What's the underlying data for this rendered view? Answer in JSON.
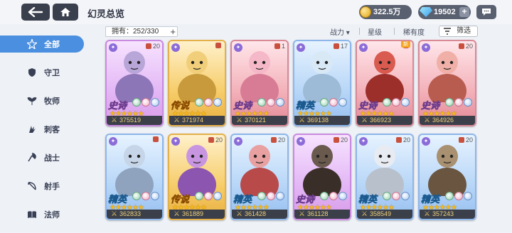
{
  "header": {
    "title": "幻灵总览",
    "gold": "322.5万",
    "gems": "19502"
  },
  "sidebar": {
    "items": [
      {
        "label": "全部",
        "icon": "star-burst-icon",
        "active": true
      },
      {
        "label": "守卫",
        "icon": "shield-icon",
        "active": false
      },
      {
        "label": "牧师",
        "icon": "wings-icon",
        "active": false
      },
      {
        "label": "刺客",
        "icon": "claw-icon",
        "active": false
      },
      {
        "label": "战士",
        "icon": "axe-icon",
        "active": false
      },
      {
        "label": "射手",
        "icon": "bow-icon",
        "active": false
      },
      {
        "label": "法师",
        "icon": "book-icon",
        "active": false
      }
    ]
  },
  "toolbar": {
    "owned_label": "拥有：252/330",
    "sort_power": "战力 ▾",
    "sort_star": "星级",
    "sort_rarity": "稀有度",
    "filter_label": "筛选"
  },
  "colors": {
    "accent": "#4a8fe0",
    "topbar_button": "#3a3f4e",
    "power_bar": "#3b3f4a"
  },
  "cards": [
    {
      "grade": "史诗",
      "level": "20",
      "power": "375519",
      "rarity": "epic",
      "new": false
    },
    {
      "grade": "传说",
      "level": "",
      "power": "371974",
      "rarity": "legend",
      "new": false
    },
    {
      "grade": "史诗",
      "level": "1",
      "power": "370121",
      "rarity": "epic-red",
      "new": false
    },
    {
      "grade": "精英",
      "level": "17",
      "power": "369138",
      "rarity": "elite",
      "new": false
    },
    {
      "grade": "史诗",
      "level": "",
      "power": "366923",
      "rarity": "epic-red",
      "new": true
    },
    {
      "grade": "史诗",
      "level": "20",
      "power": "364926",
      "rarity": "epic-red",
      "new": false
    },
    {
      "grade": "精英",
      "level": "",
      "power": "362833",
      "rarity": "elite",
      "new": false
    },
    {
      "grade": "传说",
      "level": "20",
      "power": "361889",
      "rarity": "legend",
      "new": false
    },
    {
      "grade": "精英",
      "level": "20",
      "power": "361428",
      "rarity": "elite",
      "new": false
    },
    {
      "grade": "史诗",
      "level": "20",
      "power": "361128",
      "rarity": "epic",
      "new": false
    },
    {
      "grade": "精英",
      "level": "20",
      "power": "358549",
      "rarity": "elite",
      "new": false
    },
    {
      "grade": "精英",
      "level": "20",
      "power": "357243",
      "rarity": "elite",
      "new": false
    }
  ],
  "new_tag": "新"
}
